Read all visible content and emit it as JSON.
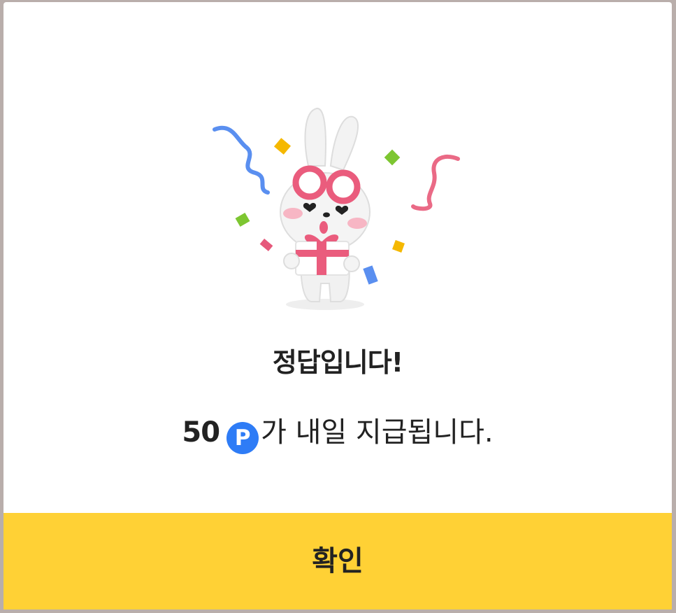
{
  "dialog": {
    "illustration": {
      "icon": "rabbit-with-gift-icon",
      "confetti_colors": [
        "#5a8ff0",
        "#e6587b",
        "#f5b800",
        "#7dc631"
      ]
    },
    "title": "정답입니다!",
    "reward": {
      "amount": "50",
      "point_symbol": "P",
      "point_color": "#2e7cf6",
      "suffix": "가 내일 지급됩니다."
    },
    "confirm_button": {
      "label": "확인",
      "color": "#ffd135"
    }
  }
}
